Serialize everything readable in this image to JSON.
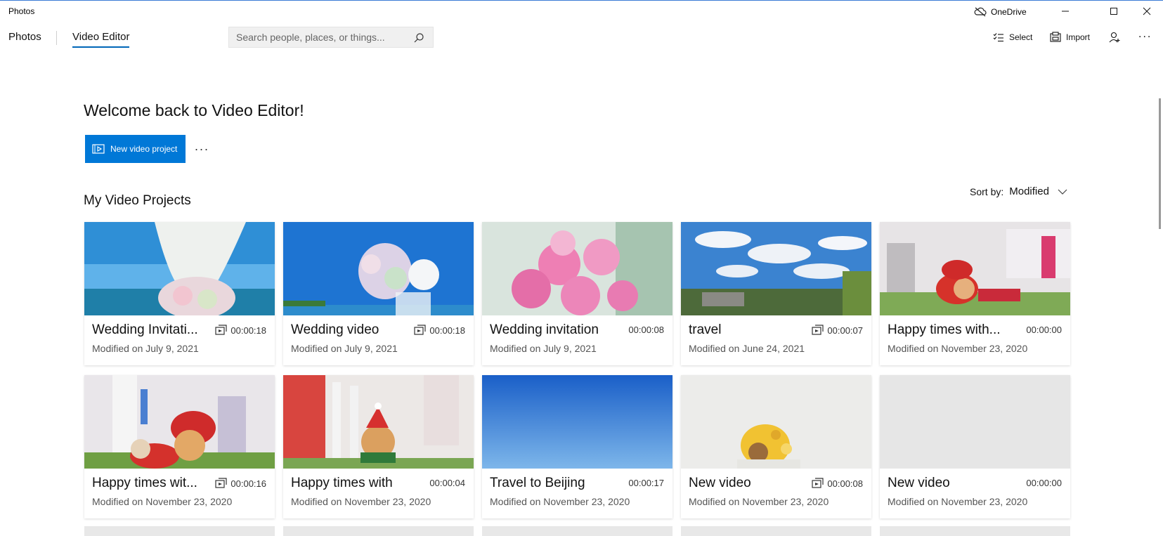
{
  "window": {
    "app_title": "Photos",
    "onedrive_label": "OneDrive",
    "controls": [
      "minimize-icon",
      "maximize-icon",
      "close-icon"
    ]
  },
  "nav": {
    "tabs": [
      {
        "label": "Photos",
        "active": false
      },
      {
        "label": "Video Editor",
        "active": true
      }
    ],
    "search": {
      "value": "",
      "placeholder": "Search people, places, or things..."
    },
    "commands": [
      {
        "label": "Select",
        "icon": "multi-select-icon"
      },
      {
        "label": "Import",
        "icon": "import-icon"
      },
      {
        "label": "",
        "icon": "add-person-icon"
      },
      {
        "label": "...",
        "icon": "more-icon"
      }
    ]
  },
  "main": {
    "welcome": "Welcome back to Video Editor!",
    "new_project_label": "New video project",
    "more_label": "...",
    "section_title": "My Video Projects",
    "sort_label": "Sort by:",
    "sort_value": "Modified"
  },
  "projects": [
    {
      "title": "Wedding Invitati...",
      "duration": "00:00:18",
      "modified": "Modified on July 9, 2021",
      "has_video_icon": true
    },
    {
      "title": "Wedding video",
      "duration": "00:00:18",
      "modified": "Modified on July 9, 2021",
      "has_video_icon": true
    },
    {
      "title": "Wedding invitation",
      "duration": "00:00:08",
      "modified": "Modified on July 9, 2021",
      "has_video_icon": false
    },
    {
      "title": "travel",
      "duration": "00:00:07",
      "modified": "Modified on June 24, 2021",
      "has_video_icon": true
    },
    {
      "title": "Happy times with...",
      "duration": "00:00:00",
      "modified": "Modified on November 23, 2020",
      "has_video_icon": false
    },
    {
      "title": "Happy times wit...",
      "duration": "00:00:16",
      "modified": "Modified on November 23, 2020",
      "has_video_icon": true
    },
    {
      "title": "Happy times with",
      "duration": "00:00:04",
      "modified": "Modified on November 23, 2020",
      "has_video_icon": false
    },
    {
      "title": "Travel to Beijing",
      "duration": "00:00:17",
      "modified": "Modified on November 23, 2020",
      "has_video_icon": false
    },
    {
      "title": "New video",
      "duration": "00:00:08",
      "modified": "Modified on November 23, 2020",
      "has_video_icon": true
    },
    {
      "title": "New video",
      "duration": "00:00:00",
      "modified": "Modified on November 23, 2020",
      "has_video_icon": false
    }
  ],
  "colors": {
    "accent": "#0078d7",
    "tab_underline": "#0067b8",
    "placeholder_thumb": "#e6e6e6"
  }
}
